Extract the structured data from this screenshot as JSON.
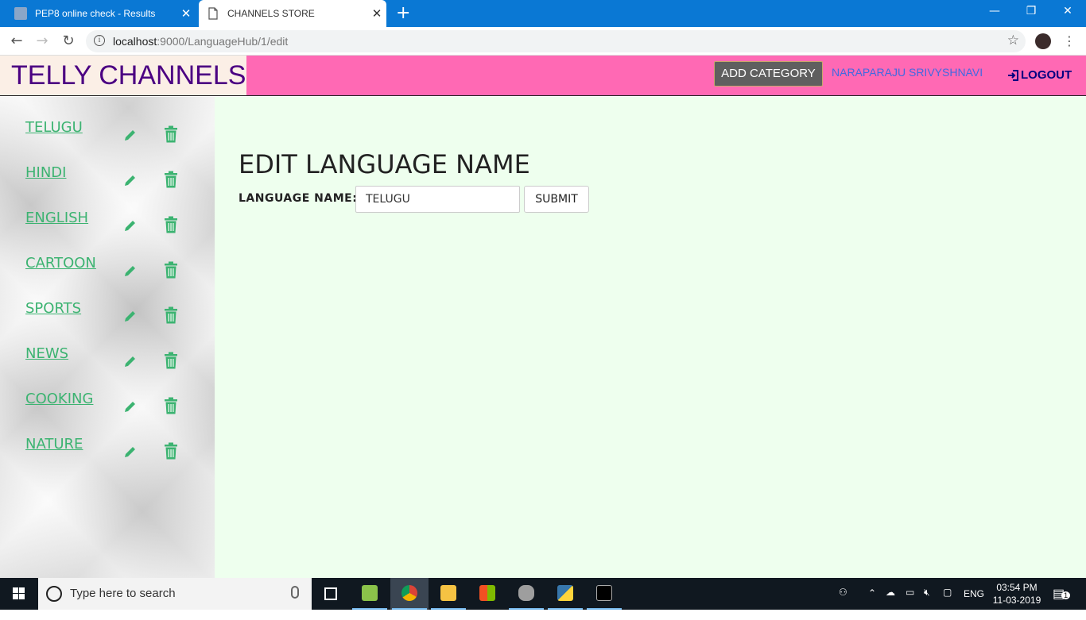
{
  "browser": {
    "tabs": [
      {
        "title": "PEP8 online check - Results"
      },
      {
        "title": "CHANNELS STORE"
      }
    ],
    "url_host": "localhost",
    "url_rest": ":9000/LanguageHub/1/edit"
  },
  "header": {
    "brand": "TELLY CHANNELS",
    "add_category": "ADD CATEGORY",
    "username": "NARAPARAJU SRIVYSHNAVI",
    "logout": "LOGOUT"
  },
  "sidebar": {
    "items": [
      {
        "label": "TELUGU"
      },
      {
        "label": "HINDI"
      },
      {
        "label": "ENGLISH"
      },
      {
        "label": "CARTOON"
      },
      {
        "label": "SPORTS"
      },
      {
        "label": "NEWS"
      },
      {
        "label": "COOKING"
      },
      {
        "label": "NATURE"
      }
    ]
  },
  "main": {
    "title": "EDIT LANGUAGE NAME",
    "label": "LANGUAGE NAME:",
    "input_value": "TELUGU",
    "submit": "SUBMIT"
  },
  "taskbar": {
    "search_placeholder": "Type here to search",
    "lang": "ENG",
    "time": "03:54 PM",
    "date": "11-03-2019",
    "notifications": "1"
  },
  "colors": {
    "accent_pink": "#ff69b4",
    "brand_purple": "#4b0082",
    "link_green": "#3cb371",
    "main_bg": "#eeffee"
  }
}
